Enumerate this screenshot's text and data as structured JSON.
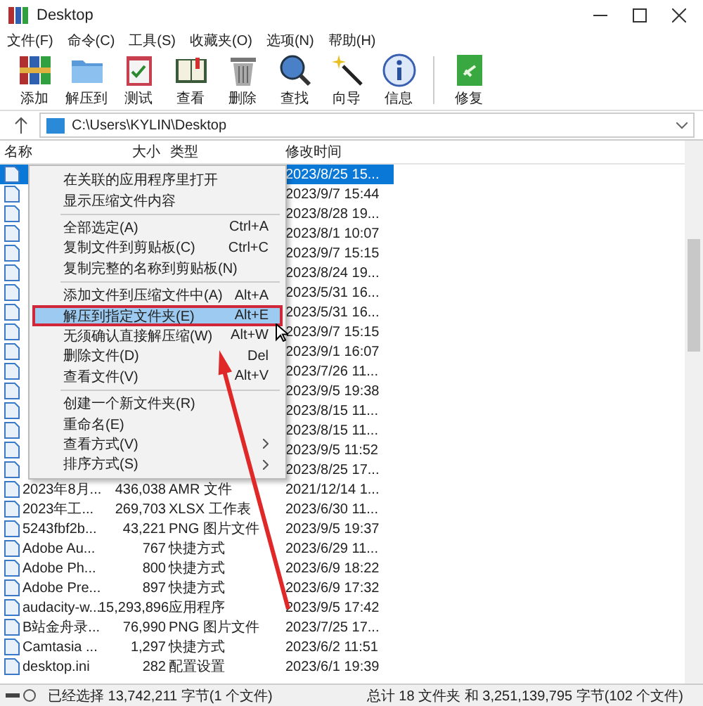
{
  "window": {
    "title": "Desktop"
  },
  "menu_bar": [
    "文件(F)",
    "命令(C)",
    "工具(S)",
    "收藏夹(O)",
    "选项(N)",
    "帮助(H)"
  ],
  "toolbar": {
    "main": [
      "添加",
      "解压到",
      "测试",
      "查看",
      "删除",
      "查找",
      "向导",
      "信息"
    ],
    "extra": [
      "修复"
    ]
  },
  "address": {
    "path": "C:\\Users\\KYLIN\\Desktop"
  },
  "columns": [
    "名称",
    "大小",
    "类型",
    "修改时间"
  ],
  "rows": [
    {
      "modified": "2023/8/25 15...",
      "selected": true
    },
    {
      "modified": "2023/9/7 15:44",
      "selected": false
    },
    {
      "modified": "2023/8/28 19...",
      "selected": false
    },
    {
      "modified": "2023/8/1 10:07",
      "selected": false
    },
    {
      "modified": "2023/9/7 15:15",
      "selected": false
    },
    {
      "modified": "2023/8/24 19...",
      "selected": false
    },
    {
      "modified": "2023/5/31 16...",
      "selected": false
    },
    {
      "modified": "2023/5/31 16...",
      "selected": false
    },
    {
      "modified": "2023/9/7 15:15",
      "selected": false
    },
    {
      "modified": "2023/9/1 16:07",
      "selected": false
    },
    {
      "modified": "2023/7/26 11...",
      "selected": false
    },
    {
      "modified": "2023/9/5 19:38",
      "selected": false
    },
    {
      "modified": "2023/8/15 11...",
      "selected": false
    },
    {
      "modified": "2023/8/15 11...",
      "selected": false
    },
    {
      "modified": "2023/9/5 11:52",
      "selected": false
    },
    {
      "modified": "2023/8/25 17...",
      "selected": false
    },
    {
      "name": "2023年8月...",
      "size": "436,038",
      "type": "AMR 文件",
      "modified": "2021/12/14 1...",
      "selected": false
    },
    {
      "name": "2023年工...",
      "size": "269,703",
      "type": "XLSX 工作表",
      "modified": "2023/6/30 11...",
      "selected": false
    },
    {
      "name": "5243fbf2b...",
      "size": "43,221",
      "type": "PNG 图片文件",
      "modified": "2023/9/5 19:37",
      "selected": false
    },
    {
      "name": "Adobe Au...",
      "size": "767",
      "type": "快捷方式",
      "modified": "2023/6/29 11...",
      "selected": false
    },
    {
      "name": "Adobe Ph...",
      "size": "800",
      "type": "快捷方式",
      "modified": "2023/6/9 18:22",
      "selected": false
    },
    {
      "name": "Adobe Pre...",
      "size": "897",
      "type": "快捷方式",
      "modified": "2023/6/9 17:32",
      "selected": false
    },
    {
      "name": "audacity-w...",
      "size": "15,293,896",
      "type": "应用程序",
      "modified": "2023/9/5 17:42",
      "selected": false
    },
    {
      "name": "B站金舟录...",
      "size": "76,990",
      "type": "PNG 图片文件",
      "modified": "2023/7/25 17...",
      "selected": false
    },
    {
      "name": "Camtasia ...",
      "size": "1,297",
      "type": "快捷方式",
      "modified": "2023/6/2 11:51",
      "selected": false
    },
    {
      "name": "desktop.ini",
      "size": "282",
      "type": "配置设置",
      "modified": "2023/6/1 19:39",
      "selected": false
    }
  ],
  "context_menu": {
    "items": [
      {
        "kind": "item",
        "label": "在关联的应用程序里打开",
        "selected": false,
        "submenu": false
      },
      {
        "kind": "item",
        "label": "显示压缩文件内容",
        "selected": false,
        "submenu": false
      },
      {
        "kind": "separator"
      },
      {
        "kind": "item",
        "label": "全部选定(A)",
        "shortcut": "Ctrl+A",
        "selected": false,
        "submenu": false
      },
      {
        "kind": "item",
        "label": "复制文件到剪贴板(C)",
        "shortcut": "Ctrl+C",
        "selected": false,
        "submenu": false
      },
      {
        "kind": "item",
        "label": "复制完整的名称到剪贴板(N)",
        "selected": false,
        "submenu": false
      },
      {
        "kind": "separator"
      },
      {
        "kind": "item",
        "label": "添加文件到压缩文件中(A)",
        "shortcut": "Alt+A",
        "selected": false,
        "submenu": false
      },
      {
        "kind": "item",
        "label": "解压到指定文件夹(E)",
        "shortcut": "Alt+E",
        "selected": true,
        "submenu": false
      },
      {
        "kind": "item",
        "label": "无须确认直接解压缩(W)",
        "shortcut": "Alt+W",
        "selected": false,
        "submenu": false
      },
      {
        "kind": "item",
        "label": "删除文件(D)",
        "shortcut": "Del",
        "selected": false,
        "submenu": false
      },
      {
        "kind": "item",
        "label": "查看文件(V)",
        "shortcut": "Alt+V",
        "selected": false,
        "submenu": false
      },
      {
        "kind": "separator"
      },
      {
        "kind": "item",
        "label": "创建一个新文件夹(R)",
        "selected": false,
        "submenu": false
      },
      {
        "kind": "item",
        "label": "重命名(E)",
        "selected": false,
        "submenu": false
      },
      {
        "kind": "item",
        "label": "查看方式(V)",
        "selected": false,
        "submenu": true
      },
      {
        "kind": "item",
        "label": "排序方式(S)",
        "selected": false,
        "submenu": true
      }
    ]
  },
  "status_bar": {
    "left": "已经选择 13,742,211 字节(1 个文件)",
    "right": "总计 18 文件夹 和 3,251,139,795 字节(102 个文件)"
  }
}
